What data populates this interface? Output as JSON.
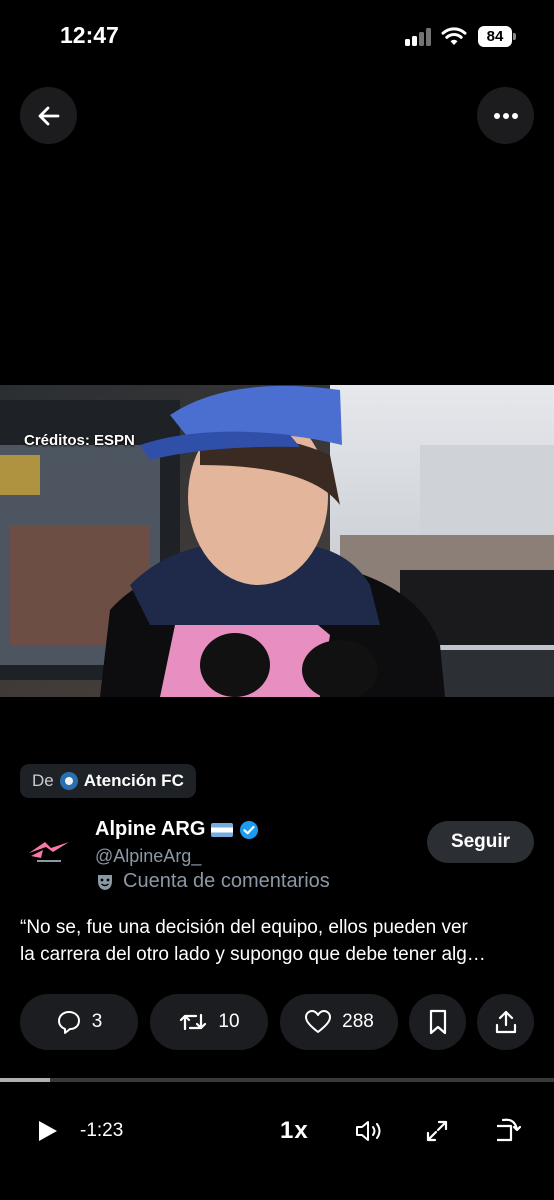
{
  "status_bar": {
    "time": "12:47",
    "battery": "84"
  },
  "video": {
    "credits": "Créditos: ESPN"
  },
  "source": {
    "prefix": "De",
    "name": "Atención FC"
  },
  "author": {
    "name": "Alpine ARG",
    "handle": "@AlpineArg_",
    "label": "Cuenta de comentarios",
    "follow_label": "Seguir"
  },
  "tweet": {
    "text_line1": "“No se, fue una decisión del equipo, ellos pueden ver",
    "text_line2": "la carrera del otro lado y supongo que debe tener alg…"
  },
  "actions": {
    "replies": "3",
    "retweets": "10",
    "likes": "288"
  },
  "player": {
    "progress": 0.09,
    "remaining": "-1:23",
    "speed": "1x"
  },
  "colors": {
    "background": "#000000",
    "verified": "#1d9bf0",
    "alpine_pink": "#f57aa8"
  }
}
